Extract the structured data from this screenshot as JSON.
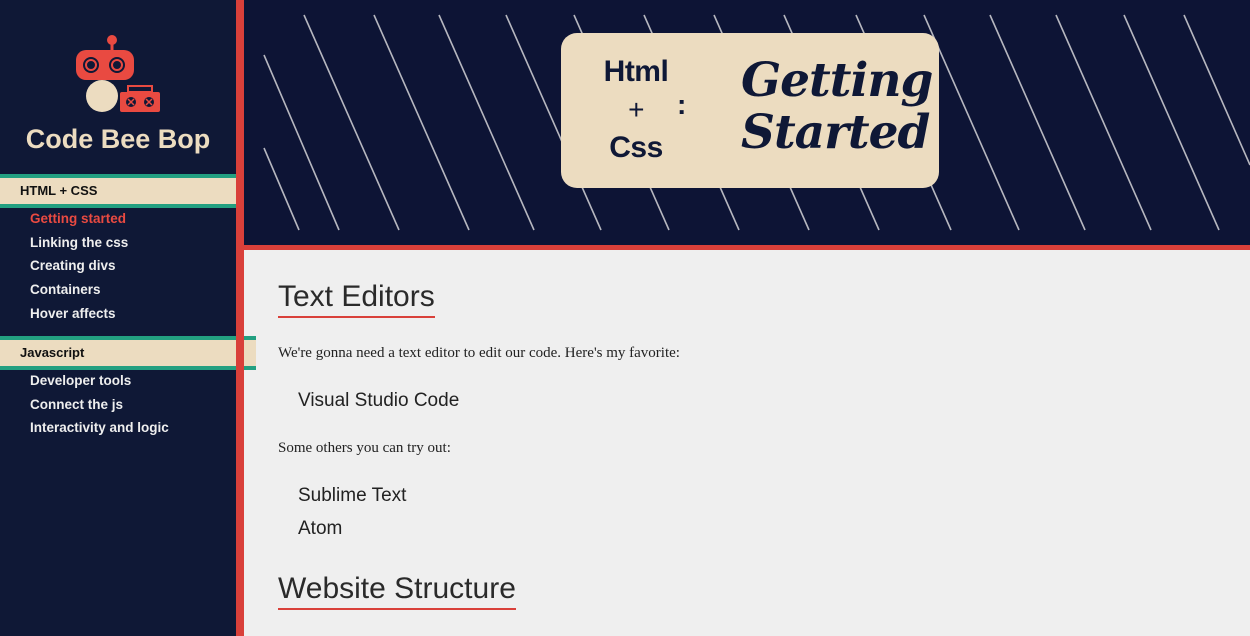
{
  "brand": {
    "name": "Code Bee Bop"
  },
  "sidebar": {
    "sections": [
      {
        "label": "HTML + CSS",
        "items": [
          {
            "label": "Getting started",
            "active": true
          },
          {
            "label": "Linking the css"
          },
          {
            "label": "Creating divs"
          },
          {
            "label": "Containers"
          },
          {
            "label": "Hover affects"
          }
        ]
      },
      {
        "label": "Javascript",
        "items": [
          {
            "label": "Developer tools"
          },
          {
            "label": "Connect the js"
          },
          {
            "label": "Interactivity and logic"
          }
        ]
      }
    ]
  },
  "banner": {
    "left_line1": "Html",
    "left_plus": "+",
    "left_line2": "Css",
    "colon": ":",
    "right_line1": "Getting",
    "right_line2": "Started"
  },
  "content": {
    "heading1": "Text Editors",
    "para1": "We're gonna need a text editor to edit our code. Here's my favorite:",
    "favorite": "Visual Studio Code",
    "para2": "Some others you can try out:",
    "others": [
      "Sublime Text",
      "Atom"
    ],
    "heading2": "Website Structure"
  },
  "colors": {
    "navy": "#0f1836",
    "accent_red": "#d9403a",
    "cream": "#ecdcc0",
    "teal": "#23a081"
  }
}
